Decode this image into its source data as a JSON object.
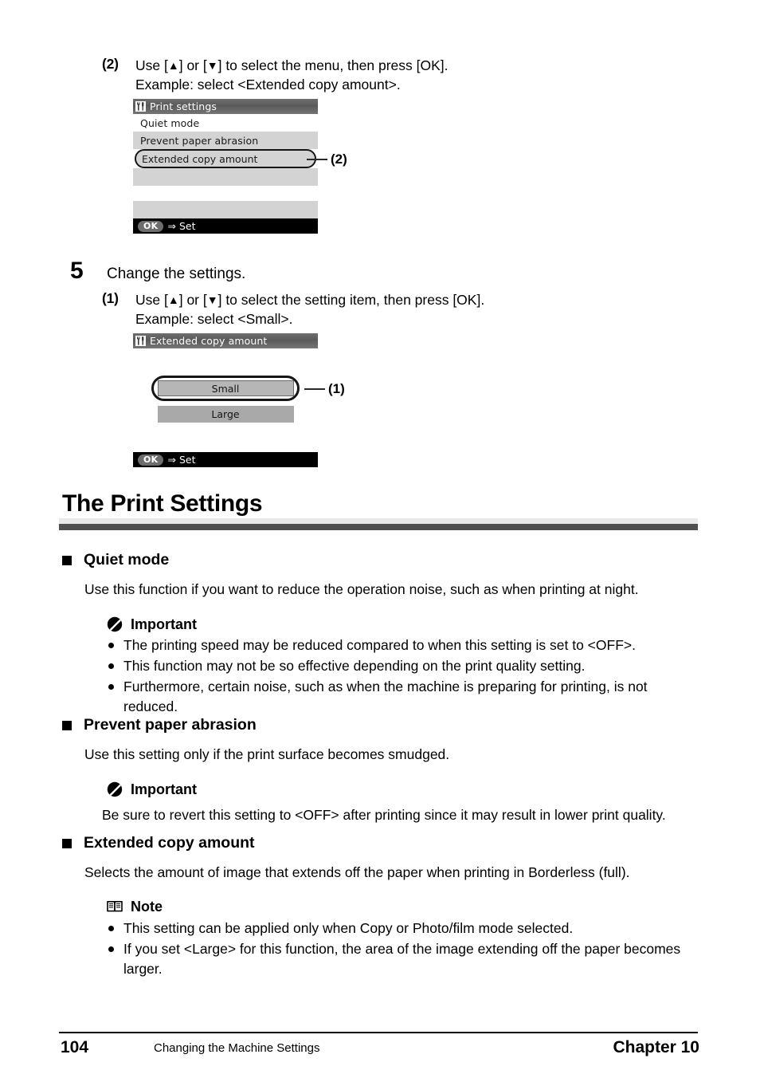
{
  "step2": {
    "number": "(2)",
    "line1_pre": "Use [",
    "line1_up": "▲",
    "line1_mid": "] or [",
    "line1_down": "▼",
    "line1_post": "] to select the menu, then press [OK].",
    "line2": "Example: select <Extended copy amount>."
  },
  "lcd1": {
    "title": "Print settings",
    "title_icon": "tools-icon",
    "rows": [
      {
        "label": "Quiet mode",
        "shade": "white"
      },
      {
        "label": "Prevent paper abrasion",
        "shade": "gray"
      }
    ],
    "selected_row": "Extended copy amount",
    "ok_label": "OK",
    "ok_arrow": "⇒",
    "ok_action": "Set"
  },
  "callout_lcd1": {
    "label": "(2)"
  },
  "step5": {
    "number": "5",
    "title": "Change the settings."
  },
  "step5_1": {
    "number": "(1)",
    "line1_pre": "Use [",
    "line1_up": "▲",
    "line1_mid": "] or [",
    "line1_down": "▼",
    "line1_post": "] to select the setting item, then press [OK].",
    "line2": "Example: select <Small>."
  },
  "lcd2": {
    "title": "Extended copy amount",
    "title_icon": "tools-icon",
    "selected_option": "Small",
    "option": "Large",
    "ok_label": "OK",
    "ok_arrow": "⇒",
    "ok_action": "Set"
  },
  "callout_lcd2": {
    "label": "(1)"
  },
  "section": {
    "title": "The Print Settings"
  },
  "quiet_mode": {
    "heading": "Quiet mode",
    "paragraph": "Use this function if you want to reduce the operation noise, such as when printing at night.",
    "important_label": "Important",
    "important_icon": "important-icon",
    "bullets": [
      "The printing speed may be reduced compared to when this setting is set to <OFF>.",
      "This function may not be so effective depending on the print quality setting.",
      "Furthermore, certain noise, such as when the machine is preparing for printing, is not reduced."
    ]
  },
  "prevent_abrasion": {
    "heading": "Prevent paper abrasion",
    "paragraph": "Use this setting only if the print surface becomes smudged.",
    "important_label": "Important",
    "important_icon": "important-icon",
    "note_text": "Be sure to revert this setting to <OFF> after printing since it may result in lower print quality."
  },
  "extended_copy": {
    "heading": "Extended copy amount",
    "paragraph": "Selects the amount of image that extends off the paper when printing in Borderless (full).",
    "note_label": "Note",
    "note_icon": "book-icon",
    "bullets": [
      "This setting can be applied only when Copy or Photo/film mode selected.",
      "If you set <Large> for this function, the area of the image extending off the paper becomes larger."
    ]
  },
  "footer": {
    "page_number": "104",
    "middle": "Changing the Machine Settings",
    "chapter": "Chapter 10"
  }
}
